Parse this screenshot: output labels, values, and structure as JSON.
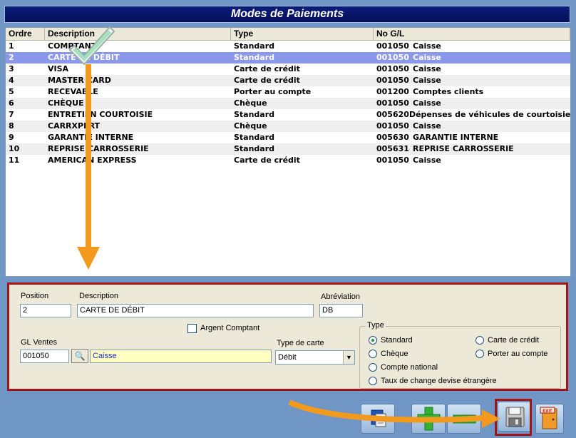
{
  "window": {
    "title": "Modes de Paiements"
  },
  "grid": {
    "columns": [
      "Ordre",
      "Description",
      "Type",
      "No G/L"
    ],
    "rows": [
      {
        "ordre": "1",
        "description": "COMPTANT",
        "type": "Standard",
        "gl_no": "001050",
        "gl_name": "Caisse"
      },
      {
        "ordre": "2",
        "description": "CARTE DE DÉBIT",
        "type": "Standard",
        "gl_no": "001050",
        "gl_name": "Caisse",
        "selected": true
      },
      {
        "ordre": "3",
        "description": "VISA",
        "type": "Carte de crédit",
        "gl_no": "001050",
        "gl_name": "Caisse"
      },
      {
        "ordre": "4",
        "description": "MASTER CARD",
        "type": "Carte de crédit",
        "gl_no": "001050",
        "gl_name": "Caisse"
      },
      {
        "ordre": "5",
        "description": "RECEVABLE",
        "type": "Porter au compte",
        "gl_no": "001200",
        "gl_name": "Comptes clients"
      },
      {
        "ordre": "6",
        "description": "CHÈQUE",
        "type": "Chèque",
        "gl_no": "001050",
        "gl_name": "Caisse"
      },
      {
        "ordre": "7",
        "description": "ENTRETIEN COURTOISIE",
        "type": "Standard",
        "gl_no": "005620",
        "gl_name": "Dépenses de véhicules de courtoisie"
      },
      {
        "ordre": "8",
        "description": "CARRXPERT",
        "type": "Chèque",
        "gl_no": "001050",
        "gl_name": "Caisse"
      },
      {
        "ordre": "9",
        "description": "GARANTIE INTERNE",
        "type": "Standard",
        "gl_no": "005630",
        "gl_name": "GARANTIE INTERNE"
      },
      {
        "ordre": "10",
        "description": "REPRISE CARROSSERIE",
        "type": "Standard",
        "gl_no": "005631",
        "gl_name": "REPRISE CARROSSERIE"
      },
      {
        "ordre": "11",
        "description": "AMERICAN EXPRESS",
        "type": "Carte de crédit",
        "gl_no": "001050",
        "gl_name": "Caisse"
      }
    ]
  },
  "form": {
    "position_label": "Position",
    "position_value": "2",
    "description_label": "Description",
    "description_value": "CARTE DE DÉBIT",
    "abbreviation_label": "Abréviation",
    "abbreviation_value": "DB",
    "argent_comptant_label": "Argent Comptant",
    "argent_comptant_checked": false,
    "gl_ventes_label": "GL Ventes",
    "gl_ventes_value": "001050",
    "gl_ventes_name": "Caisse",
    "type_carte_label": "Type de carte",
    "type_carte_value": "Débit",
    "type_group_label": "Type",
    "type_options": [
      "Standard",
      "Chèque",
      "Compte national",
      "Taux de change devise étrangère",
      "Carte de crédit",
      "Porter au compte"
    ],
    "type_selected": "Standard"
  },
  "toolbar": {
    "buttons": [
      "copy-button",
      "add-button",
      "delete-button",
      "save-button",
      "exit-button"
    ],
    "exit_icon_text": "EXIT"
  },
  "colors": {
    "selection": "#8b97ea",
    "title_bar": "#0c1e7a",
    "highlight_border": "#a41414",
    "annotation_arrow": "#f39a1e"
  }
}
